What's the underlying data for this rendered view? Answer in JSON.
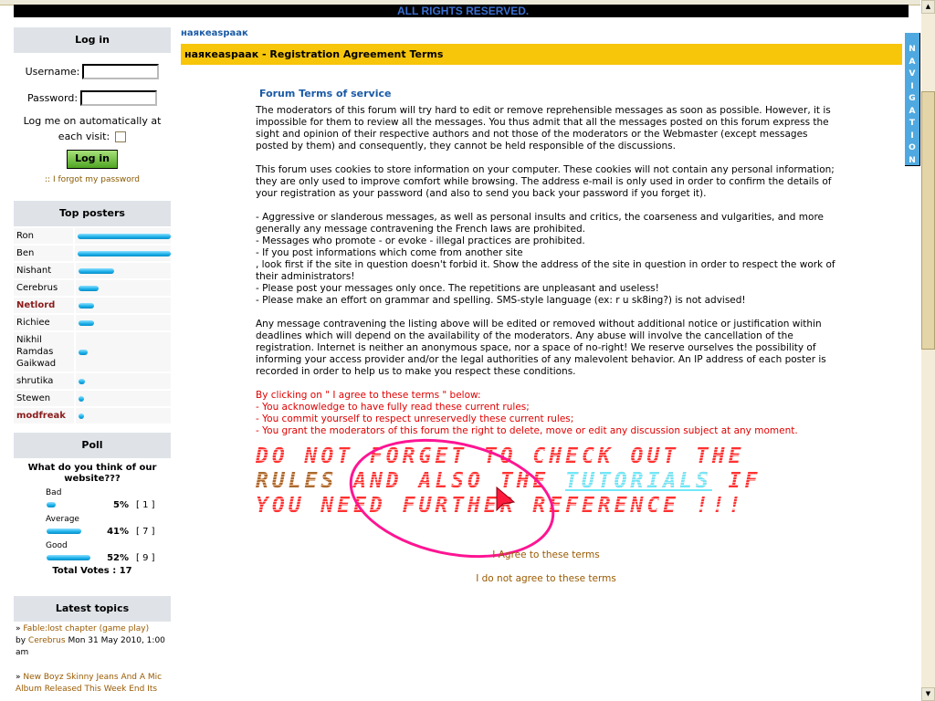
{
  "header": {
    "rights_text": "ALL RIGHTS RESERVED."
  },
  "breadcrumb": "наякеаspаак",
  "page_title": "наякеаspаак - Registration Agreement Terms",
  "login": {
    "title": "Log in",
    "username_label": "Username:",
    "username_value": "",
    "password_label": "Password:",
    "password_value": "",
    "remember_label": "Log me on automatically at each visit:",
    "remember_checked": false,
    "button_label": "Log in",
    "forgot_label": ":: I forgot my password"
  },
  "top_posters": {
    "title": "Top posters",
    "items": [
      {
        "name": "Ron",
        "share": 1.0,
        "highlight": false
      },
      {
        "name": "Ben",
        "share": 1.0,
        "highlight": false
      },
      {
        "name": "Nishant",
        "share": 0.38,
        "highlight": false
      },
      {
        "name": "Cerebrus",
        "share": 0.22,
        "highlight": false
      },
      {
        "name": "Netlord",
        "share": 0.17,
        "highlight": true
      },
      {
        "name": "Richiee",
        "share": 0.17,
        "highlight": false
      },
      {
        "name": "Nikhil Ramdas Gaikwad",
        "share": 0.1,
        "highlight": false
      },
      {
        "name": "shrutika",
        "share": 0.07,
        "highlight": false
      },
      {
        "name": "Stewen",
        "share": 0.05,
        "highlight": false
      },
      {
        "name": "modfreak",
        "share": 0.05,
        "highlight": true
      }
    ]
  },
  "poll": {
    "title": "Poll",
    "question": "What do you think of our website???",
    "options": [
      {
        "label": "Bad",
        "percent": 5,
        "percent_text": "5%",
        "votes_text": "[ 1 ]"
      },
      {
        "label": "Average",
        "percent": 41,
        "percent_text": "41%",
        "votes_text": "[ 7 ]"
      },
      {
        "label": "Good",
        "percent": 52,
        "percent_text": "52%",
        "votes_text": "[ 9 ]"
      }
    ],
    "total_text": "Total Votes : 17"
  },
  "latest_topics": {
    "title": "Latest topics",
    "items": [
      {
        "prefix": "» ",
        "title": "Fable:lost chapter (game play)",
        "by": "by ",
        "author": "Cerebrus",
        "date": " Mon 31 May 2010, 1:00 am"
      },
      {
        "prefix": "» ",
        "title": "New Boyz Skinny Jeans And A Mic Album Released This Week End Its",
        "by": "",
        "author": "",
        "date": ""
      }
    ]
  },
  "terms": {
    "heading": "Forum Terms of service",
    "paragraphs": [
      "The moderators of this forum will try hard to edit or remove reprehensible messages as soon as possible. However, it is impossible for them to review all the messages. You thus admit that all the messages posted on this forum express the sight and opinion of their respective authors and not those of the moderators or the Webmaster (except messages posted by them) and consequently, they cannot be held responsible of the discussions.",
      "This forum uses cookies to store information on your computer. These cookies will not contain any personal information; they are only used to improve comfort while browsing. The address e-mail is only used in order to confirm the details of your registration as your password (and also to send you back your password if you forget it).",
      "- Aggressive or slanderous messages, as well as personal insults and critics, the coarseness and vulgarities, and more generally any message contravening the French laws are prohibited.\n- Messages who promote - or evoke - illegal practices are prohibited.\n- If you post informations which come from another site\n, look first if the site in question doesn't forbid it. Show the address of the site in question in order to respect the work of their administrators!\n- Please post your messages only once. The repetitions are unpleasant and useless!\n- Please make an effort on grammar and spelling. SMS-style language (ex: r u sk8ing?) is not advised!",
      "Any message contravening the listing above will be edited or removed without additional notice or justification within deadlines which will depend on the availability of the moderators. Any abuse will involve the cancellation of the registration. Internet is neither an anonymous space, nor a space of no-right! We reserve ourselves the possibility of informing your access provider and/or the legal authorities of any malevolent behavior. An IP address of each poster is recorded in order to help us to make you respect these conditions."
    ],
    "agreement_text": "By clicking on \" I agree to these terms \" below:\n- You acknowledge to have fully read these current rules;\n- You commit yourself to respect unreservedly these current rules;\n- You grant the moderators of this forum the right to delete, move or edit any discussion subject at any moment.",
    "notice": {
      "part1": "DO NOT FORGET TO CHECK OUT THE ",
      "rules_link": "RULES",
      "part2": " AND ALSO THE ",
      "tutorials_link": "TUTORIALS",
      "part3": " IF YOU NEED FURTHER REFERENCE !!!"
    },
    "agree_label": "I Agree to these terms",
    "disagree_label": "I do not agree to these terms"
  },
  "navigation_tab": "NAVIGATION",
  "colors": {
    "title_bar": "#f7c50a",
    "link": "#9a5a00",
    "heading_blue": "#1a5aa6",
    "warning_red": "#e00000",
    "nav_tab": "#4fa9e0",
    "annotation_circle": "#ff1493"
  }
}
